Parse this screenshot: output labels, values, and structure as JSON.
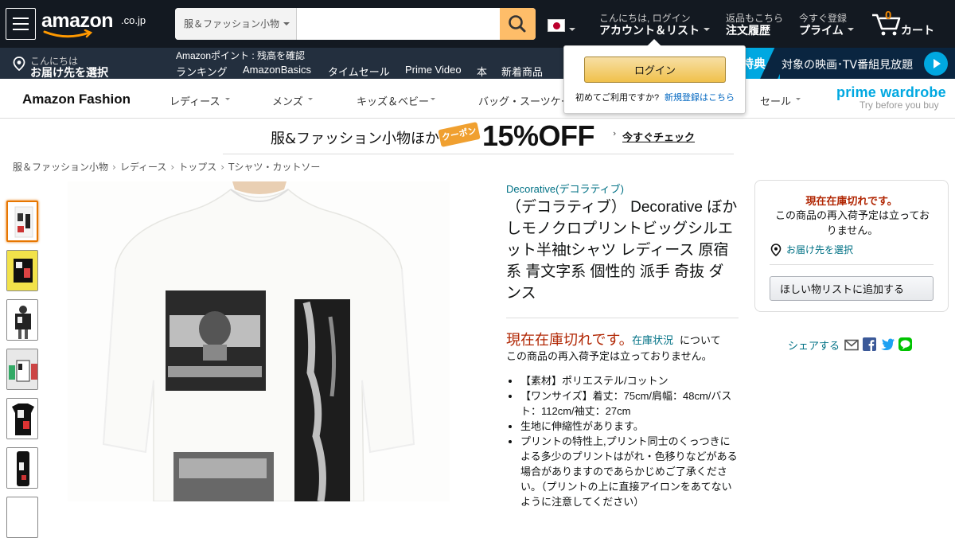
{
  "nav": {
    "logo_word": "amazon",
    "logo_tld": ".co.jp",
    "search_category": "服＆ファッション小物",
    "search_placeholder": "",
    "greeting_small": "こんにちは, ログイン",
    "account_label": "アカウント＆リスト",
    "returns_small": "返品もこちら",
    "orders_label": "注文履歴",
    "prime_small": "今すぐ登録",
    "prime_label": "プライム",
    "cart_count": "0",
    "cart_label": "カート"
  },
  "nav_main": {
    "deliver_small": "こんにちは",
    "deliver_label": "お届け先を選択",
    "points_text": "Amazonポイント : 残高を確認",
    "links": [
      "ランキング",
      "AmazonBasics",
      "タイムセール",
      "Prime Video",
      "本",
      "新着商品"
    ],
    "promo_prefix": "特典",
    "promo_text": "対象の映画･TV番組見放題"
  },
  "fashion_nav": {
    "title": "Amazon Fashion",
    "items": [
      "レディース",
      "メンズ",
      "キッズ＆ベビー",
      "バッグ・スーツケース",
      "セール"
    ],
    "prime_wardrobe": "prime wardrobe",
    "prime_wardrobe_sub": "Try before you buy"
  },
  "coupon": {
    "text": "服&ファッション小物ほか",
    "badge": "クーポン",
    "percent": "15%OFF",
    "link": "今すぐチェック"
  },
  "breadcrumb": [
    "服＆ファッション小物",
    "レディース",
    "トップス",
    "Tシャツ・カットソー"
  ],
  "product": {
    "brand": "Decorative(デコラティブ)",
    "title": "（デコラティブ） Decorative ぼかしモノクロプリントビッグシルエット半袖tシャツ レディース 原宿系 青文字系 個性的 派手 奇抜 ダンス",
    "stock_status": "現在在庫切れです。",
    "stock_link": "在庫状況",
    "stock_note": "について",
    "restock_note": "この商品の再入荷予定は立っておりません。",
    "features": [
      "【素材】ポリエステル/コットン",
      "【ワンサイズ】着丈：75cm/肩幅：48cm/バスト：112cm/袖丈：27cm",
      "生地に伸縮性があります。",
      "プリントの特性上,プリント同士のくっつきによる多少のプリントはがれ・色移りなどがある場合がありますのであらかじめご了承ください。（プリントの上に直接アイロンをあてないように注意してください）"
    ]
  },
  "buybox": {
    "status": "現在在庫切れです。",
    "note": "この商品の再入荷予定は立っておりません。",
    "deliver": "お届け先を選択",
    "wishlist": "ほしい物リストに追加する"
  },
  "share": {
    "label": "シェアする",
    "icons": [
      "mail-icon",
      "facebook-icon",
      "twitter-icon",
      "line-icon"
    ]
  },
  "flyout": {
    "login": "ログイン",
    "first_time": "初めてご利用ですか?",
    "signup": "新規登録はこちら"
  },
  "colors": {
    "nav_dark": "#131921",
    "nav_main": "#232f3e",
    "search_button": "#febd69",
    "cart_count": "#f08804",
    "link": "#007185",
    "out_of_stock": "#b12704",
    "prime_blue": "#00a8e1",
    "thumb_selected": "#e77600",
    "login_button": "#f0c14b"
  }
}
